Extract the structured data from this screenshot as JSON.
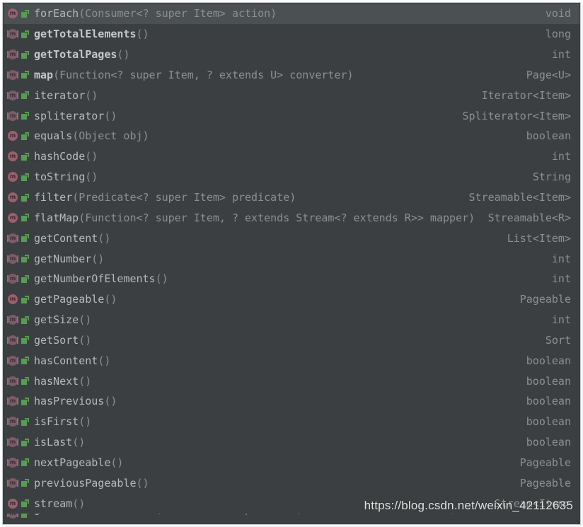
{
  "popup": {
    "kind": "code-completion-popup",
    "ide": "IntelliJ IDEA",
    "theme_colors": {
      "background": "#3c3f41",
      "selected_background": "#4b5053",
      "border": "#c9ccd1",
      "method_icon": "#9b5f6e",
      "visibility_icon": "#5a9a57",
      "name_text": "#b4bbbb",
      "params_text": "#8b9190",
      "return_type_text": "#8b9190"
    },
    "selected_index": 0,
    "icons": {
      "method": "method-icon",
      "visibility": "public-lock-icon"
    }
  },
  "watermark": {
    "text": "https://blog.csdn.net/weixin_42112635"
  },
  "items": [
    {
      "name": "forEach",
      "params": "(Consumer<? super Item> action)",
      "type": "void",
      "declared": false,
      "inherited": false,
      "selected": true
    },
    {
      "name": "getTotalElements",
      "params": "()",
      "type": "long",
      "declared": true,
      "inherited": true,
      "selected": false
    },
    {
      "name": "getTotalPages",
      "params": "()",
      "type": "int",
      "declared": true,
      "inherited": true,
      "selected": false
    },
    {
      "name": "map",
      "params": "(Function<? super Item, ? extends U> converter)",
      "type": "Page<U>",
      "declared": true,
      "inherited": true,
      "selected": false
    },
    {
      "name": "iterator",
      "params": "()",
      "type": "Iterator<Item>",
      "declared": false,
      "inherited": true,
      "selected": false
    },
    {
      "name": "spliterator",
      "params": "()",
      "type": "Spliterator<Item>",
      "declared": false,
      "inherited": true,
      "selected": false
    },
    {
      "name": "equals",
      "params": "(Object obj)",
      "type": "boolean",
      "declared": false,
      "inherited": false,
      "selected": false
    },
    {
      "name": "hashCode",
      "params": "()",
      "type": "int",
      "declared": false,
      "inherited": false,
      "selected": false
    },
    {
      "name": "toString",
      "params": "()",
      "type": "String",
      "declared": false,
      "inherited": false,
      "selected": false
    },
    {
      "name": "filter",
      "params": "(Predicate<? super Item> predicate)",
      "type": "Streamable<Item>",
      "declared": false,
      "inherited": false,
      "selected": false
    },
    {
      "name": "flatMap",
      "params": "(Function<? super Item, ? extends Stream<? extends R>> mapper)",
      "type": "Streamable<R>",
      "declared": false,
      "inherited": false,
      "selected": false
    },
    {
      "name": "getContent",
      "params": "()",
      "type": "List<Item>",
      "declared": false,
      "inherited": true,
      "selected": false
    },
    {
      "name": "getNumber",
      "params": "()",
      "type": "int",
      "declared": false,
      "inherited": true,
      "selected": false
    },
    {
      "name": "getNumberOfElements",
      "params": "()",
      "type": "int",
      "declared": false,
      "inherited": true,
      "selected": false
    },
    {
      "name": "getPageable",
      "params": "()",
      "type": "Pageable",
      "declared": false,
      "inherited": false,
      "selected": false
    },
    {
      "name": "getSize",
      "params": "()",
      "type": "int",
      "declared": false,
      "inherited": true,
      "selected": false
    },
    {
      "name": "getSort",
      "params": "()",
      "type": "Sort",
      "declared": false,
      "inherited": true,
      "selected": false
    },
    {
      "name": "hasContent",
      "params": "()",
      "type": "boolean",
      "declared": false,
      "inherited": true,
      "selected": false
    },
    {
      "name": "hasNext",
      "params": "()",
      "type": "boolean",
      "declared": false,
      "inherited": true,
      "selected": false
    },
    {
      "name": "hasPrevious",
      "params": "()",
      "type": "boolean",
      "declared": false,
      "inherited": true,
      "selected": false
    },
    {
      "name": "isFirst",
      "params": "()",
      "type": "boolean",
      "declared": false,
      "inherited": true,
      "selected": false
    },
    {
      "name": "isLast",
      "params": "()",
      "type": "boolean",
      "declared": false,
      "inherited": true,
      "selected": false
    },
    {
      "name": "nextPageable",
      "params": "()",
      "type": "Pageable",
      "declared": false,
      "inherited": true,
      "selected": false
    },
    {
      "name": "previousPageable",
      "params": "()",
      "type": "Pageable",
      "declared": false,
      "inherited": true,
      "selected": false
    },
    {
      "name": "stream",
      "params": "()",
      "type": "Stream<Item>",
      "declared": false,
      "inherited": false,
      "selected": false
    },
    {
      "name": "getConvertedContent",
      "params": "(Function<? super Item, ? extends U> converter)",
      "type": "List<U>",
      "declared": false,
      "inherited": true,
      "selected": false,
      "clipped": true
    }
  ]
}
